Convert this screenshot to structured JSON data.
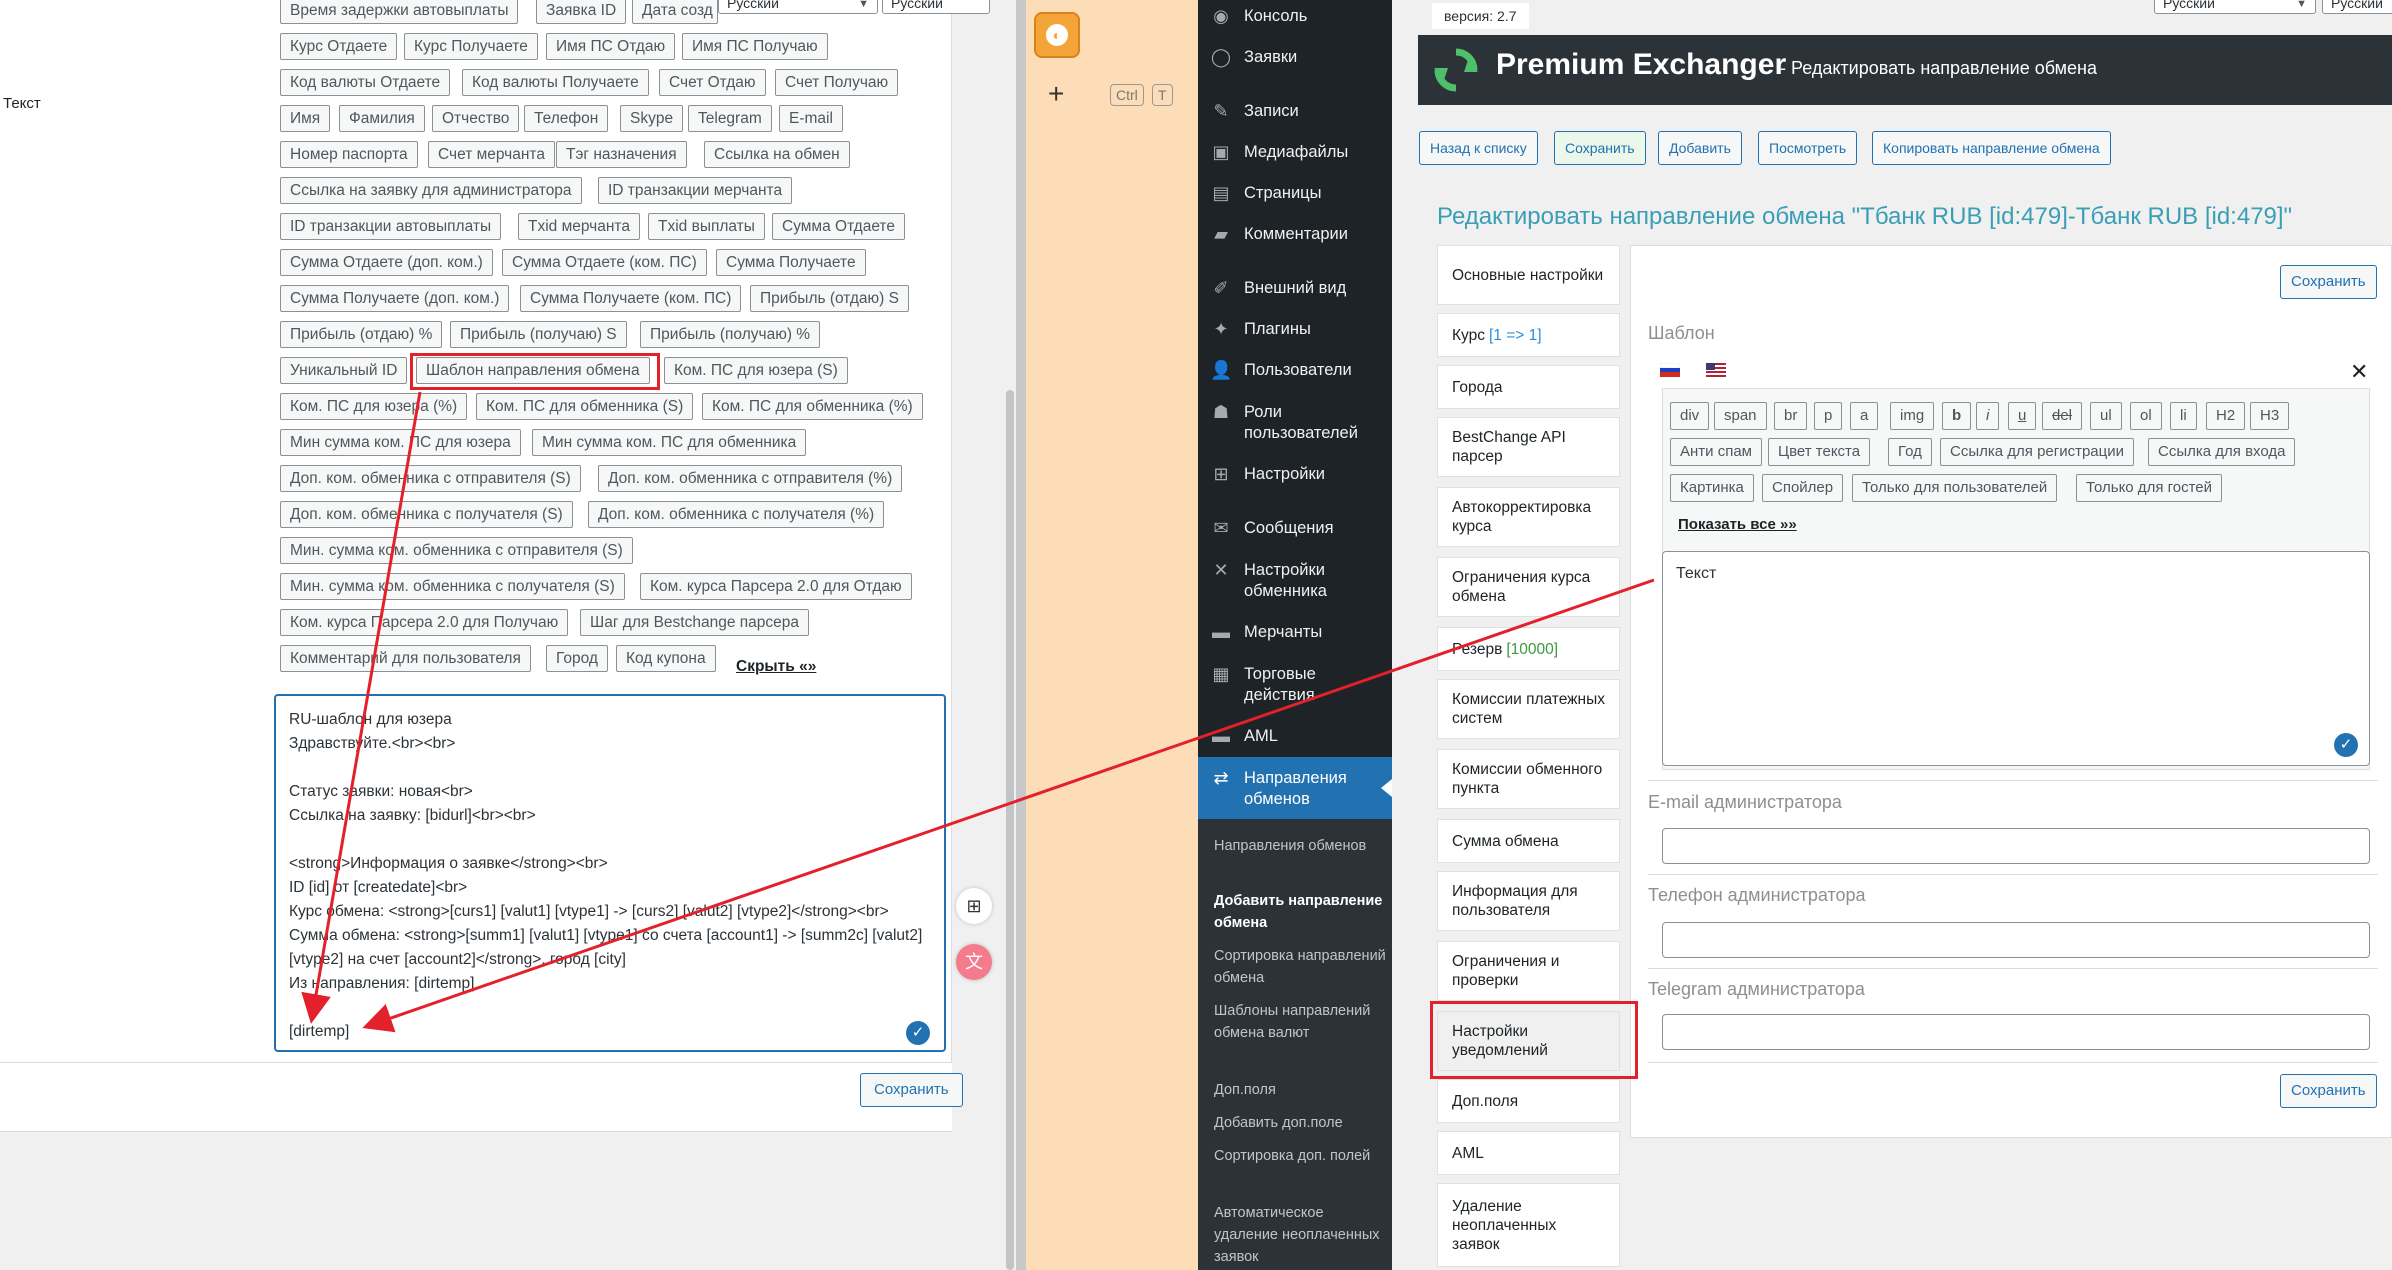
{
  "left": {
    "label_text": "Текст",
    "lang_select_1": "Русский",
    "lang_select_2": "Русский",
    "tags": [
      "Время задержки автовыплаты",
      "Заявка ID",
      "Дата созд",
      "Курс Отдаете",
      "Курс Получаете",
      "Имя ПС Отдаю",
      "Имя ПС Получаю",
      "Код валюты Отдаете",
      "Код валюты Получаете",
      "Счет Отдаю",
      "Счет Получаю",
      "Имя",
      "Фамилия",
      "Отчество",
      "Телефон",
      "Skype",
      "Telegram",
      "E-mail",
      "Номер паспорта",
      "Счет мерчанта",
      "Тэг назначения",
      "Ссылка на обмен",
      "Ссылка на заявку для администратора",
      "ID транзакции мерчанта",
      "ID транзакции автовыплаты",
      "Txid мерчанта",
      "Txid выплаты",
      "Сумма Отдаете",
      "Сумма Отдаете (доп. ком.)",
      "Сумма Отдаете (ком. ПС)",
      "Сумма Получаете",
      "Сумма Получаете (доп. ком.)",
      "Сумма Получаете (ком. ПС)",
      "Прибыль (отдаю) S",
      "Прибыль (отдаю) %",
      "Прибыль (получаю) S",
      "Прибыль (получаю) %",
      "Уникальный ID",
      "Шаблон направления обмена",
      "Ком. ПС для юзера (S)",
      "Ком. ПС для юзера (%)",
      "Ком. ПС для обменника (S)",
      "Ком. ПС для обменника (%)",
      "Мин сумма ком. ПС для юзера",
      "Мин сумма ком. ПС для обменника",
      "Доп. ком. обменника с отправителя (S)",
      "Доп. ком. обменника с отправителя (%)",
      "Доп. ком. обменника с получателя (S)",
      "Доп. ком. обменника с получателя (%)",
      "Мин. сумма ком. обменника с отправителя (S)",
      "Мин. сумма ком. обменника с получателя (S)",
      "Ком. курса Парсера 2.0 для Отдаю",
      "Ком. курса Парсера 2.0 для Получаю",
      "Шаг для Bestchange парсера",
      "Комментарий для пользователя",
      "Город",
      "Код купона"
    ],
    "hide_all": "Скрыть «»",
    "textarea_value": "RU-шаблон для юзера\nЗдравствуйте.<br><br>\n\nСтатус заявки: новая<br>\nСсылка на заявку: [bidurl]<br><br>\n\n<strong>Информация о заявке</strong><br>\nID [id] от [createdate]<br>\nКурс обмена: <strong>[curs1] [valut1] [vtype1] -> [curs2] [valut2] [vtype2]</strong><br>\nСумма обмена: <strong>[summ1] [valut1] [vtype1] со счета [account1] -> [summ2c] [valut2] [vtype2] на счет [account2]</strong>, город [city]\nИз направления: [dirtemp]\n\n[dirtemp]",
    "save_label": "Сохранить"
  },
  "middle": {
    "kbd_ctrl": "Ctrl",
    "kbd_t": "T",
    "plus": "+"
  },
  "sidebar": {
    "items": [
      {
        "icon": "◉",
        "label": "Консоль"
      },
      {
        "icon": "◯",
        "label": "Заявки"
      },
      {
        "icon": "✎",
        "label": "Записи"
      },
      {
        "icon": "▣",
        "label": "Медиафайлы"
      },
      {
        "icon": "▤",
        "label": "Страницы"
      },
      {
        "icon": "▰",
        "label": "Комментарии"
      },
      {
        "icon": "✐",
        "label": "Внешний вид"
      },
      {
        "icon": "✦",
        "label": "Плагины"
      },
      {
        "icon": "👤",
        "label": "Пользователи"
      },
      {
        "icon": "☗",
        "label": "Роли пользователей"
      },
      {
        "icon": "⊞",
        "label": "Настройки"
      },
      {
        "icon": "✉",
        "label": "Сообщения"
      },
      {
        "icon": "✕",
        "label": "Настройки обменника"
      },
      {
        "icon": "▬",
        "label": "Мерчанты"
      },
      {
        "icon": "▦",
        "label": "Торговые действия"
      },
      {
        "icon": "▬",
        "label": "AML"
      },
      {
        "icon": "⇄",
        "label": "Направления обменов"
      }
    ],
    "submenu": [
      "Направления обменов",
      "Добавить направление обмена",
      "Сортировка направлений обмена",
      "Шаблоны направлений обмена валют",
      "Доп.поля",
      "Добавить доп.поле",
      "Сортировка доп. полей",
      "Автоматическое удаление неоплаченных заявок"
    ]
  },
  "right": {
    "version": "версия: 2.7",
    "lang_select_1": "Русский",
    "lang_select_2": "Русский",
    "app_title": "Premium Exchanger",
    "app_subtitle": "- Редактировать направление обмена",
    "toolbar": [
      "Назад к списку",
      "Сохранить",
      "Добавить",
      "Посмотреть",
      "Копировать направление обмена"
    ],
    "page_title": "Редактировать направление обмена \"Тбанк RUB [id:479]-Тбанк RUB [id:479]\"",
    "tabs": [
      {
        "label": "Основные настройки",
        "extra": ""
      },
      {
        "label": "Курс",
        "extra": "[1 => 1]"
      },
      {
        "label": "Города",
        "extra": ""
      },
      {
        "label": "BestChange API парсер",
        "extra": ""
      },
      {
        "label": "Автокорректировка курса",
        "extra": ""
      },
      {
        "label": "Ограничения курса обмена",
        "extra": ""
      },
      {
        "label": "Резерв",
        "extra": "[10000]"
      },
      {
        "label": "Комиссии платежных систем",
        "extra": ""
      },
      {
        "label": "Комиссии обменного пункта",
        "extra": ""
      },
      {
        "label": "Сумма обмена",
        "extra": ""
      },
      {
        "label": "Информация для пользователя",
        "extra": ""
      },
      {
        "label": "Ограничения и проверки",
        "extra": ""
      },
      {
        "label": "Настройки уведомлений",
        "extra": ""
      },
      {
        "label": "Доп.поля",
        "extra": ""
      },
      {
        "label": "AML",
        "extra": ""
      },
      {
        "label": "Удаление неоплаченных заявок",
        "extra": ""
      }
    ],
    "save_top": "Сохранить",
    "save_bottom": "Сохранить",
    "template_label": "Шаблон",
    "editor_buttons": [
      "div",
      "span",
      "br",
      "p",
      "a",
      "img",
      "b",
      "i",
      "u",
      "del",
      "ul",
      "ol",
      "li",
      "H2",
      "H3",
      "Анти спам",
      "Цвет текста",
      "Год",
      "Ссылка для регистрации",
      "Ссылка для входа",
      "Картинка",
      "Спойлер",
      "Только для пользователей",
      "Только для гостей"
    ],
    "show_all": "Показать все »»",
    "textarea_value": "Текст",
    "email_label": "E-mail администратора",
    "phone_label": "Телефон администратора",
    "telegram_label": "Telegram администратора"
  },
  "colors": {
    "accent": "#2271b1",
    "sidebar_bg": "#1d2327",
    "highlight": "#e3212b",
    "title_teal": "#3a9fb5"
  }
}
